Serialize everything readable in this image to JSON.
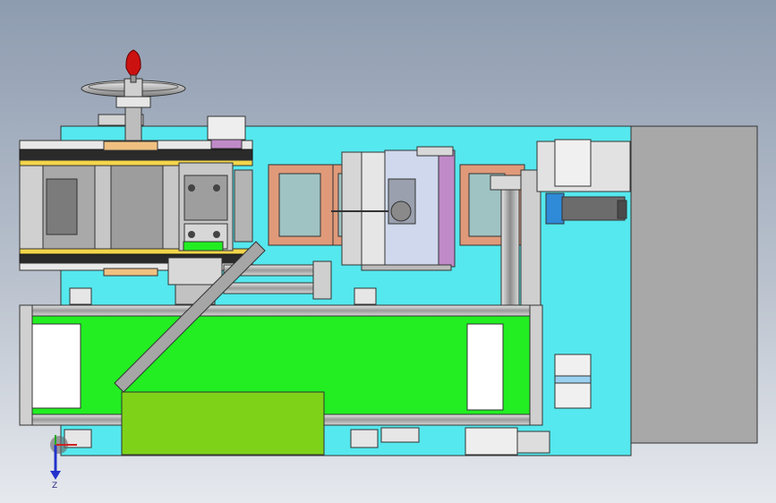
{
  "scene": {
    "background_top": "#8e9cb0",
    "background_bottom": "#e6e9ee",
    "base_plate_color": "#55e8ee",
    "conveyor_belt_color": "#22ee22",
    "product_block_color": "#7ed319",
    "cabinet_color": "#a8a8a8",
    "handle_knob_color": "#cc1111",
    "tray_border_color": "#e09a7a",
    "tray_inner_color": "#9fc3c3",
    "purple_accent_color": "#c08ac8"
  },
  "triad": {
    "icon": "coordinate-triad-icon",
    "axis_label": "Z"
  }
}
